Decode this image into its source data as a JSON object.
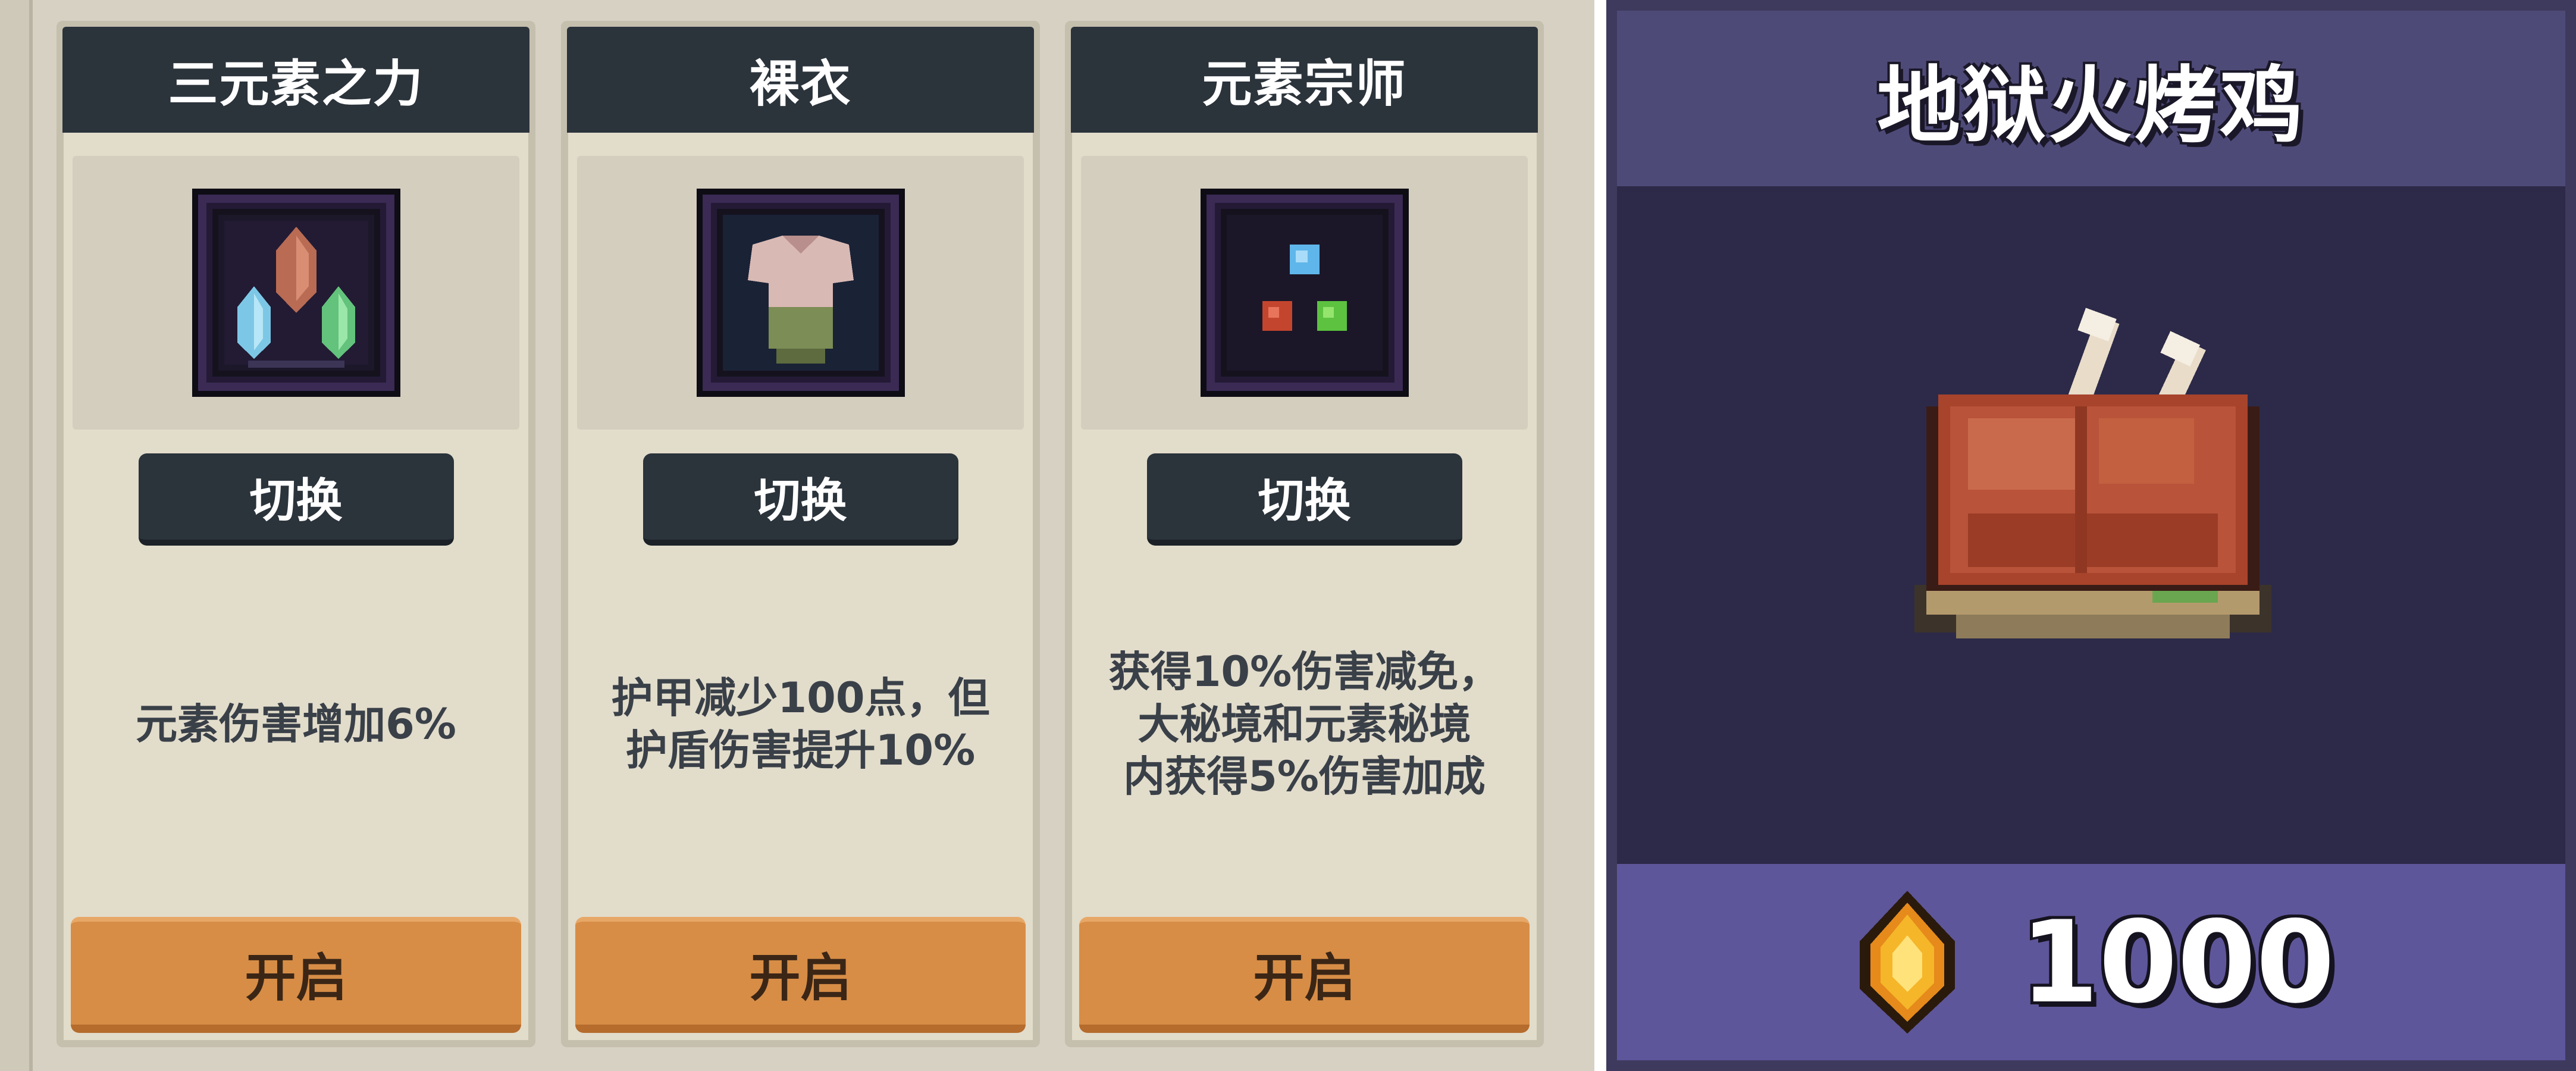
{
  "cards": [
    {
      "title": "三元素之力",
      "icon": "tri-element-crystal-icon",
      "switch_label": "切换",
      "description": "元素伤害增加6%",
      "enable_label": "开启"
    },
    {
      "title": "裸衣",
      "icon": "bare-shirt-icon",
      "switch_label": "切换",
      "description": "护甲减少100点，但\n护盾伤害提升10%",
      "enable_label": "开启"
    },
    {
      "title": "元素宗师",
      "icon": "element-master-orbs-icon",
      "switch_label": "切换",
      "description": "获得10%伤害减免，\n大秘境和元素秘境\n内获得5%伤害加成",
      "enable_label": "开启"
    }
  ],
  "shop_item": {
    "title": "地狱火烤鸡",
    "icon": "roast-chicken-icon",
    "currency_icon": "gem-icon",
    "price": "1000"
  },
  "colors": {
    "card_header": "#2b333b",
    "enable_button": "#d78d46",
    "shop_panel": "#2c2a48",
    "shop_price_bar": "#5e569a"
  }
}
